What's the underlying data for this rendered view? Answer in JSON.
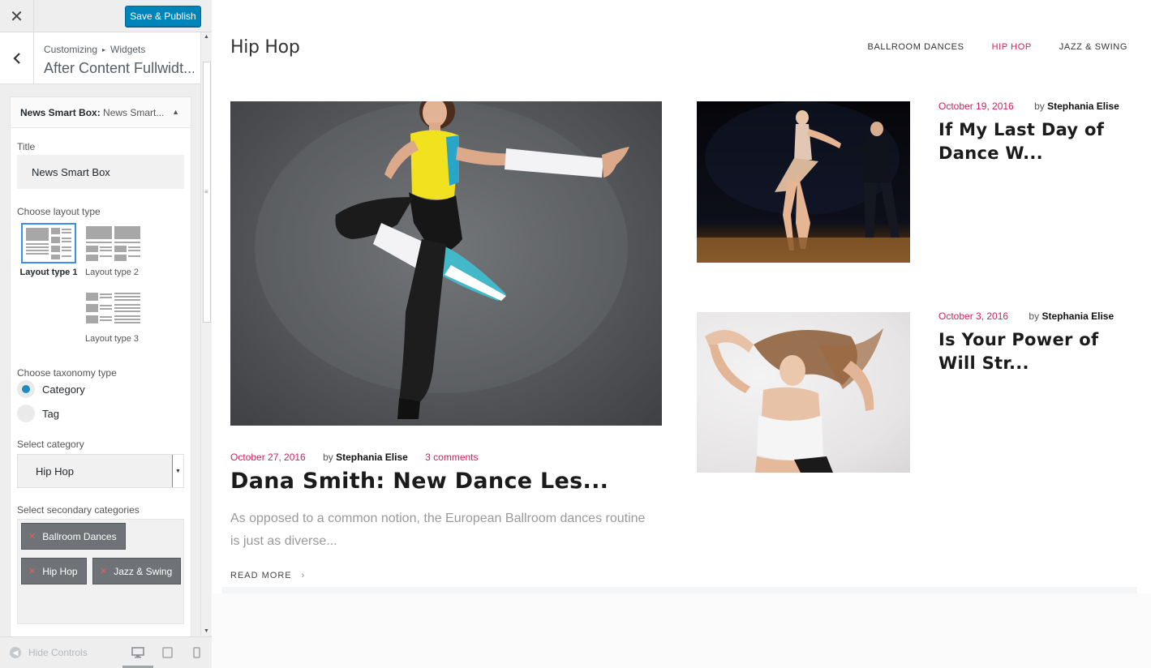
{
  "topbar": {
    "close_icon": "close-icon",
    "publish_label": "Save & Publish",
    "publish_color": "#0085ba"
  },
  "section": {
    "breadcrumb": [
      "Customizing",
      "Widgets"
    ],
    "title": "After Content Fullwidt..."
  },
  "widget": {
    "name": "News Smart Box:",
    "subtitle": "News Smart...",
    "title_label": "Title",
    "title_value": "News Smart Box",
    "layout_label": "Choose layout type",
    "layouts": [
      {
        "label": "Layout type 1",
        "selected": true
      },
      {
        "label": "Layout type 2",
        "selected": false
      },
      {
        "label": "Layout type 3",
        "selected": false
      }
    ],
    "taxonomy_label": "Choose taxonomy type",
    "taxonomy_options": [
      {
        "label": "Category",
        "selected": true
      },
      {
        "label": "Tag",
        "selected": false
      }
    ],
    "category_label": "Select category",
    "category_value": "Hip Hop",
    "secondary_label": "Select secondary categories",
    "secondary_categories": [
      "Ballroom Dances",
      "Hip Hop",
      "Jazz & Swing"
    ]
  },
  "footer": {
    "hide_controls": "Hide Controls"
  },
  "preview": {
    "site_title": "Hip Hop",
    "nav": [
      {
        "label": "BALLROOM DANCES",
        "active": false
      },
      {
        "label": "HIP HOP",
        "active": true
      },
      {
        "label": "JAZZ & SWING",
        "active": false
      }
    ],
    "accent_color": "#d0215b",
    "main_post": {
      "date": "October 27, 2016",
      "by": "by",
      "author": "Stephania Elise",
      "comments": "3 comments",
      "title": "Dana Smith: New Dance Les...",
      "excerpt": "As opposed to a common notion, the European Ballroom dances routine is just as diverse...",
      "read_more": "READ MORE"
    },
    "side_posts": [
      {
        "date": "October 19, 2016",
        "by": "by",
        "author": "Stephania Elise",
        "title": "If My Last Day of Dance W..."
      },
      {
        "date": "October 3, 2016",
        "by": "by",
        "author": "Stephania Elise",
        "title": "Is Your Power of Will Str..."
      }
    ]
  }
}
